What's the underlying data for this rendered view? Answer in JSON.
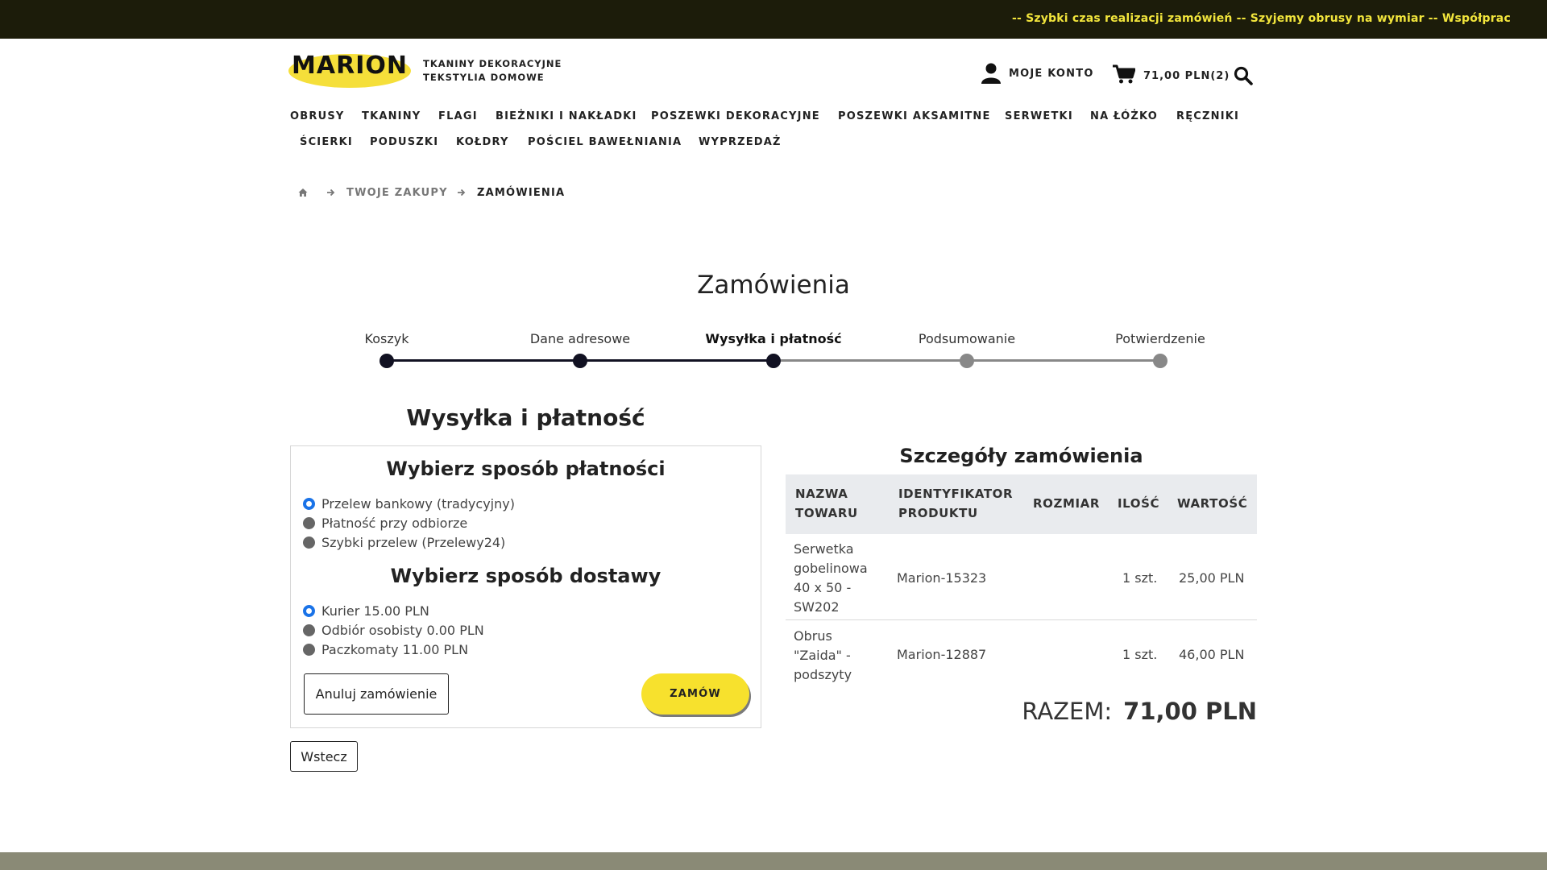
{
  "announcement": {
    "text": "--  Szybki czas realizacji zamówień  --  Szyjemy obrusy na wymiar  --  Współprac"
  },
  "header": {
    "logo_text": "MARION",
    "tagline": [
      "TKANINY DEKORACYJNE",
      "TEKSTYLIA DOMOWE"
    ],
    "account_label": "MOJE KONTO",
    "cart_label": "71,00 PLN(2)",
    "icons": [
      "user-icon",
      "cart-icon",
      "search-icon"
    ]
  },
  "nav": {
    "row1": [
      "OBRUSY",
      "TKANINY",
      "FLAGI",
      "BIEŻNIKI I NAKŁADKI",
      "POSZEWKI DEKORACYJNE",
      "POSZEWKI AKSAMITNE",
      "SERWETKI",
      "NA ŁÓŻKO",
      "RĘCZNIKI"
    ],
    "row2": [
      "ŚCIERKI",
      "PODUSZKI",
      "KOŁDRY",
      "POŚCIEL BAWEŁNIANIA",
      "WYPRZEDAŻ"
    ]
  },
  "breadcrumb": {
    "home_icon": "home-icon",
    "items": [
      "TWOJE ZAKUPY",
      "ZAMÓWIENIA"
    ]
  },
  "page": {
    "title": "Zamówienia"
  },
  "steps": {
    "labels": [
      "Koszyk",
      "Dane adresowe",
      "Wysyłka i płatność",
      "Podsumowanie",
      "Potwierdzenie"
    ],
    "active_index": 2,
    "completed_color": "#111122",
    "pending_color": "#888888"
  },
  "shipping": {
    "section_title": "Wysyłka i płatność",
    "payment_title": "Wybierz sposób płatności",
    "payment_options": [
      {
        "label": "Przelew bankowy (tradycyjny)",
        "selected": true
      },
      {
        "label": "Płatność przy odbiorze",
        "selected": false
      },
      {
        "label": "Szybki przelew (Przelewy24)",
        "selected": false
      }
    ],
    "delivery_title": "Wybierz sposób dostawy",
    "delivery_options": [
      {
        "label": "Kurier 15.00 PLN",
        "selected": true
      },
      {
        "label": "Odbiór osobisty 0.00 PLN",
        "selected": false
      },
      {
        "label": "Paczkomaty 11.00 PLN",
        "selected": false
      }
    ],
    "cancel_label": "Anuluj zamówienie",
    "order_label": "ZAMÓW",
    "back_label": "Wstecz"
  },
  "details": {
    "title": "Szczegóły zamówienia",
    "headers": {
      "name": [
        "NAZWA",
        "TOWARU"
      ],
      "product_id": [
        "IDENTYFIKATOR",
        "PRODUKTU"
      ],
      "size": "ROZMIAR",
      "qty": "ILOŚĆ",
      "value": "WARTOŚĆ"
    },
    "rows": [
      {
        "name": [
          "Serwetka",
          "gobelinowa",
          "40 x 50 -",
          "SW202"
        ],
        "product_id": "Marion-15323",
        "size": "",
        "qty": "1 szt.",
        "value": "25,00 PLN"
      },
      {
        "name": [
          "Obrus",
          "\"Zaida\" -",
          "podszyty"
        ],
        "product_id": "Marion-12887",
        "size": "",
        "qty": "1 szt.",
        "value": "46,00 PLN"
      }
    ],
    "total_label": "RAZEM:",
    "total_value": "71,00 PLN"
  },
  "colors": {
    "accent_yellow": "#f7e12d",
    "topbar": "#1c1c0a",
    "radio_selected": "#1a73e8"
  }
}
